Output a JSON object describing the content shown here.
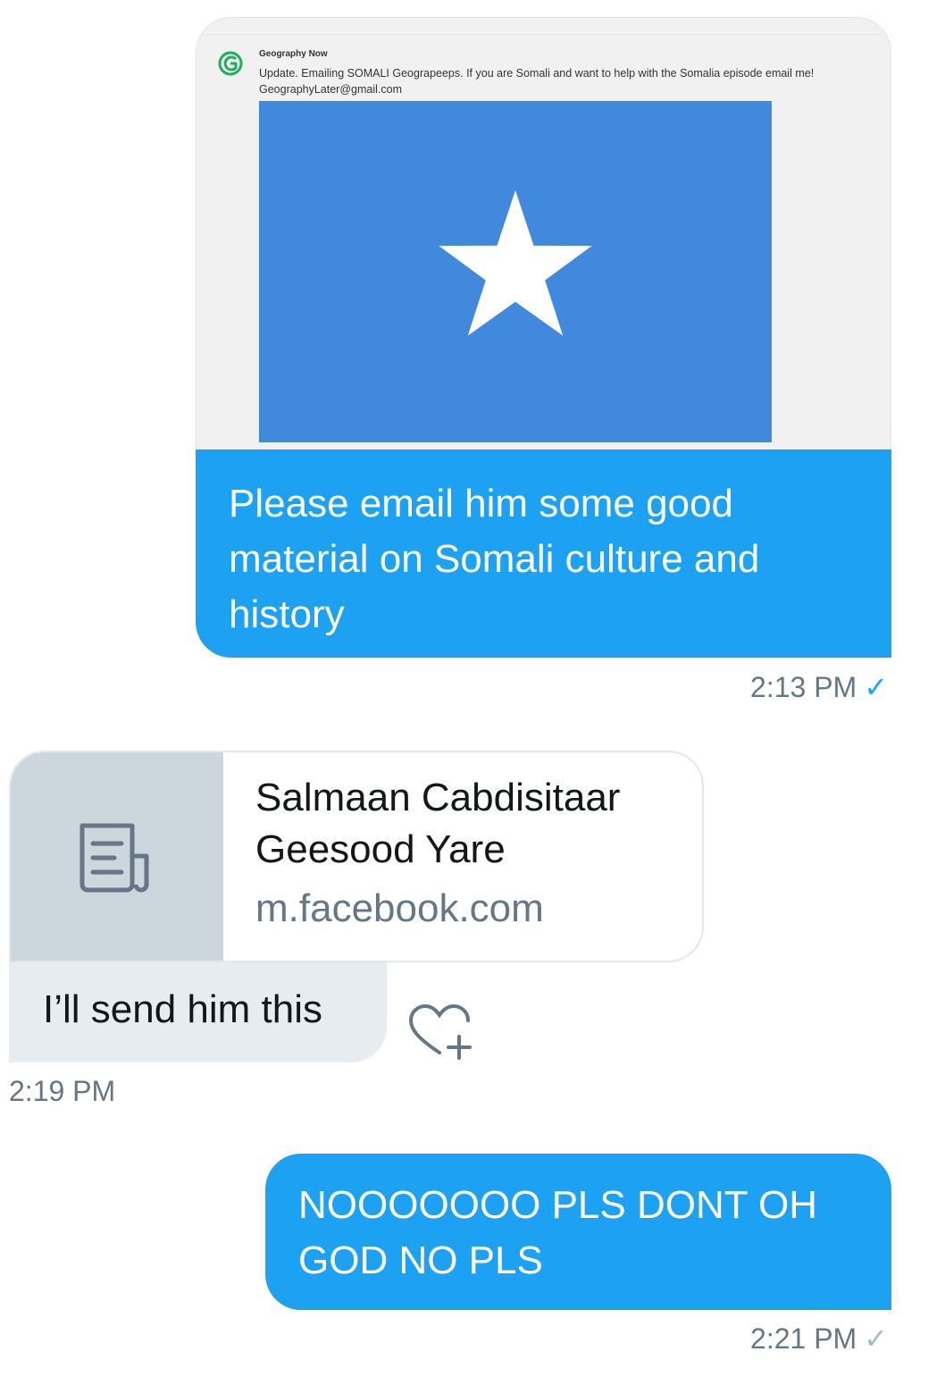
{
  "messages": [
    {
      "direction": "outgoing",
      "embed": {
        "account_name": "Geography Now",
        "tweet_text": "Update. Emailing SOMALI Geograpeeps. If you are Somali and want to help with the Somalia episode email me! GeographyLater@gmail.com",
        "image_icon": "somalia-flag",
        "flag_color": "#4189dd"
      },
      "text": "Please email him some good material on Somali culture and history",
      "time": "2:13 PM",
      "status_icon": "check-icon",
      "status_color": "#1da1f2"
    },
    {
      "direction": "incoming",
      "link_card": {
        "title": "Salmaan Cabdisitaar Geesood Yare",
        "domain": "m.facebook.com",
        "icon": "document-icon"
      },
      "text": "I’ll send him this",
      "reaction_icon": "heart-plus-icon",
      "time": "2:19 PM"
    },
    {
      "direction": "outgoing",
      "text": "NOOOOOOO PLS DONT OH GOD NO PLS",
      "time": "2:21 PM",
      "status_icon": "check-icon",
      "status_color": "#aab8c2"
    }
  ],
  "colors": {
    "outgoing_bubble": "#1da1f2",
    "incoming_bubble": "#e6ecf0",
    "link_thumb": "#ccd6dd",
    "secondary_text": "#657786"
  }
}
